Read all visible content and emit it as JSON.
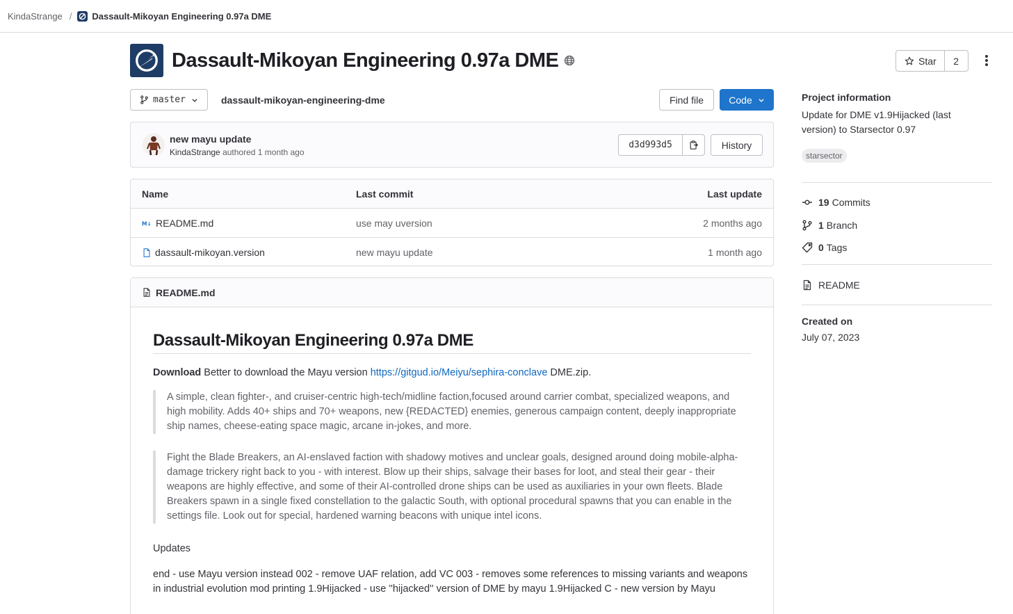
{
  "breadcrumb": {
    "owner": "KindaStrange",
    "separator": "/",
    "project": "Dassault-Mikoyan Engineering 0.97a DME"
  },
  "project": {
    "title": "Dassault-Mikoyan Engineering 0.97a DME",
    "star_label": "Star",
    "star_count": "2"
  },
  "repo": {
    "branch": "master",
    "path": "dassault-mikoyan-engineering-dme",
    "find_file_label": "Find file",
    "code_label": "Code"
  },
  "last_commit": {
    "title": "new mayu update",
    "author": "KindaStrange",
    "authored_text": "authored 1 month ago",
    "sha": "d3d993d5",
    "history_label": "History"
  },
  "file_table": {
    "headers": {
      "name": "Name",
      "last_commit": "Last commit",
      "last_update": "Last update"
    },
    "rows": [
      {
        "name": "README.md",
        "commit": "use may uversion",
        "updated": "2 months ago",
        "icon": "markdown-icon"
      },
      {
        "name": "dassault-mikoyan.version",
        "commit": "new mayu update",
        "updated": "1 month ago",
        "icon": "file-icon"
      }
    ]
  },
  "readme": {
    "filename": "README.md",
    "heading": "Dassault-Mikoyan Engineering 0.97a DME",
    "download_bold": "Download",
    "download_text": " Better to download the Mayu version ",
    "download_link": "https://gitgud.io/Meiyu/sephira-conclave",
    "download_suffix": " DME.zip.",
    "quote1": "A simple, clean fighter-, and cruiser-centric high-tech/midline faction,focused around carrier combat, specialized weapons, and high mobility. Adds 40+ ships and 70+ weapons, new {REDACTED} enemies, generous campaign content, deeply inappropriate ship names, cheese-eating space magic, arcane in-jokes, and more.",
    "quote2": "Fight the Blade Breakers, an AI-enslaved faction with shadowy motives and unclear goals, designed around doing mobile-alpha-damage trickery right back to you - with interest. Blow up their ships, salvage their bases for loot, and steal their gear - their weapons are highly effective, and some of their AI-controlled drone ships can be used as auxiliaries in your own fleets. Blade Breakers spawn in a single fixed constellation to the galactic South, with optional procedural spawns that you can enable in the settings file. Look out for special, hardened warning beacons with unique intel icons.",
    "updates_label": "Updates",
    "updates_text": "end - use Mayu version instead 002 - remove UAF relation, add VC 003 - removes some references to missing variants and weapons in industrial evolution mod printing 1.9Hijacked - use ''hijacked'' version of DME by mayu 1.9Hijacked C - new version by Mayu"
  },
  "sidebar": {
    "info_title": "Project information",
    "description": "Update for DME v1.9Hijacked (last version) to Starsector 0.97",
    "topic": "starsector",
    "commits_count": "19",
    "commits_label": "Commits",
    "branch_count": "1",
    "branch_label": "Branch",
    "tags_count": "0",
    "tags_label": "Tags",
    "readme_label": "README",
    "created_label": "Created on",
    "created_value": "July 07, 2023"
  },
  "colors": {
    "accent": "#1f75cb",
    "link": "#1068bf",
    "avatar_bg": "#1f3c66"
  }
}
